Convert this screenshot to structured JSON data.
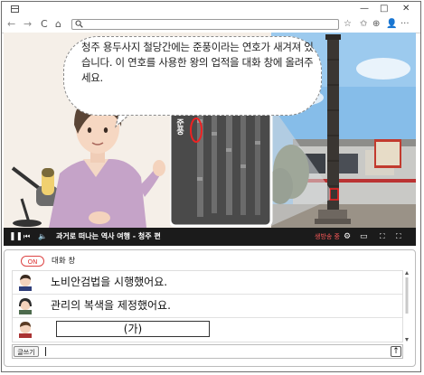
{
  "browser": {
    "minimize": "—",
    "maximize": "□",
    "close": "✕",
    "back": "←",
    "forward": "→",
    "reload": "C",
    "home": "⌂",
    "search_glyph": "🔍",
    "star": "☆",
    "favorites": "✩",
    "collections": "⊕",
    "profile": "👤",
    "menu": "···"
  },
  "bubble": {
    "text": "청주 용두사지 철당간에는 준풍이라는 연호가 새겨져 있습니다. 이 연호를 사용한 왕의 업적을 대화 창에 올려주세요."
  },
  "inset": {
    "label": "준풍"
  },
  "player": {
    "title": "과거로 떠나는 역사 여행 - 청주 편",
    "caption_toggle": "생방송 중"
  },
  "chat": {
    "on_label": "ON",
    "title": "대화 창",
    "messages": [
      {
        "text": "노비안검법을 시행했어요."
      },
      {
        "text": "관리의 복색을 제정했어요."
      }
    ],
    "blank": "(가)",
    "write_label": "글쓰기",
    "send_icon": "↑"
  },
  "colors": {
    "accent_red": "#dd3333",
    "sky": "#7fb6e6",
    "player_bg": "#1b1b1b"
  }
}
